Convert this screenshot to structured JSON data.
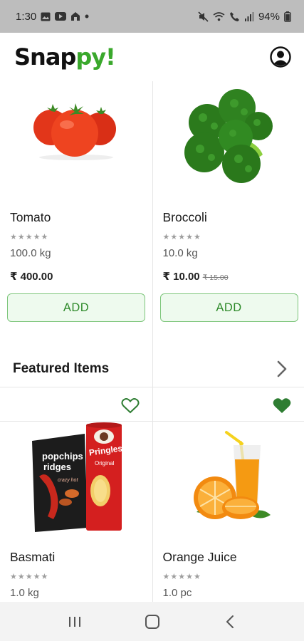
{
  "status_bar": {
    "time": "1:30",
    "battery": "94%"
  },
  "app": {
    "logo_part1": "Snap",
    "logo_part2": "py!"
  },
  "top_products": [
    {
      "name": "Tomato",
      "stars": "★★★★★",
      "quantity": "100.0 kg",
      "price": "₹ 400.00",
      "mrp": "",
      "button": "ADD"
    },
    {
      "name": "Broccoli",
      "stars": "★★★★★",
      "quantity": "10.0 kg",
      "price": "₹ 10.00",
      "mrp": "₹ 15.00",
      "button": "ADD"
    }
  ],
  "featured": {
    "title": "Featured Items",
    "items": [
      {
        "name": "Basmati",
        "stars": "★★★★★",
        "quantity": "1.0 kg",
        "favorite": false,
        "image_labels": {
          "bag_brand": "popchips",
          "bag_flavor": "ridges",
          "bag_taste": "crazy hot",
          "can_brand": "Pringles",
          "can_flavor": "Original"
        }
      },
      {
        "name": "Orange Juice",
        "stars": "★★★★★",
        "quantity": "1.0 pc",
        "favorite": true
      }
    ]
  },
  "colors": {
    "brand_green": "#3aa82c",
    "add_button_text": "#2e8a2a",
    "add_button_bg": "#eefaee",
    "heart_green": "#2e7d32"
  }
}
